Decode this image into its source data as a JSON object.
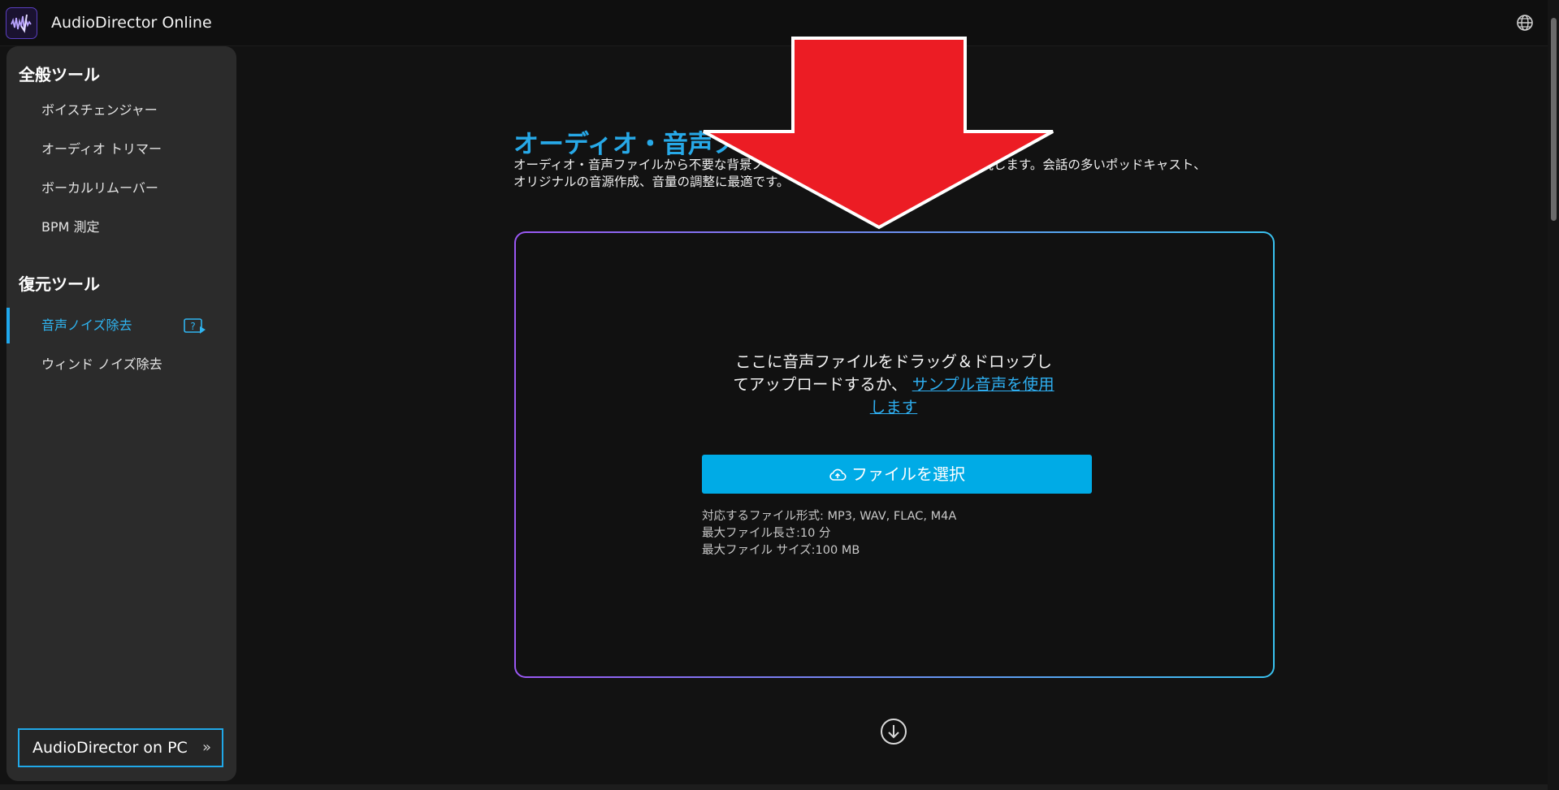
{
  "app": {
    "title": "AudioDirector Online",
    "accent": "#27a9e8"
  },
  "sidebar": {
    "general_title": "全般ツール",
    "general_items": [
      {
        "label": "ボイスチェンジャー"
      },
      {
        "label": "オーディオ トリマー"
      },
      {
        "label": "ボーカルリムーバー"
      },
      {
        "label": "BPM 測定"
      }
    ],
    "restore_title": "復元ツール",
    "restore_items": [
      {
        "label": "音声ノイズ除去",
        "active": true
      },
      {
        "label": "ウィンド ノイズ除去",
        "active": false
      }
    ],
    "pc_button_label": "AudioDirector on PC",
    "pc_button_chevrons": "»"
  },
  "main": {
    "title": "オーディオ・音声ノ",
    "description_line1": "オーディオ・音声ファイルから不要な背景ノ",
    "description_line1_end": "ドを実現します。会話の多いポッドキャスト、",
    "description_line2": "オリジナルの音源作成、音量の調整に最適です。"
  },
  "upload": {
    "drop_text": "ここに音声ファイルをドラッグ＆ドロップしてアップロードするか、",
    "sample_link": "サンプル音声を使用します",
    "select_button": "ファイルを選択",
    "formats": "対応するファイル形式: MP3, WAV, FLAC, M4A",
    "max_length": "最大ファイル長さ:10 分",
    "max_size": "最大ファイル サイズ:100 MB"
  },
  "overlay": {
    "arrow_color": "#ec1c24"
  }
}
